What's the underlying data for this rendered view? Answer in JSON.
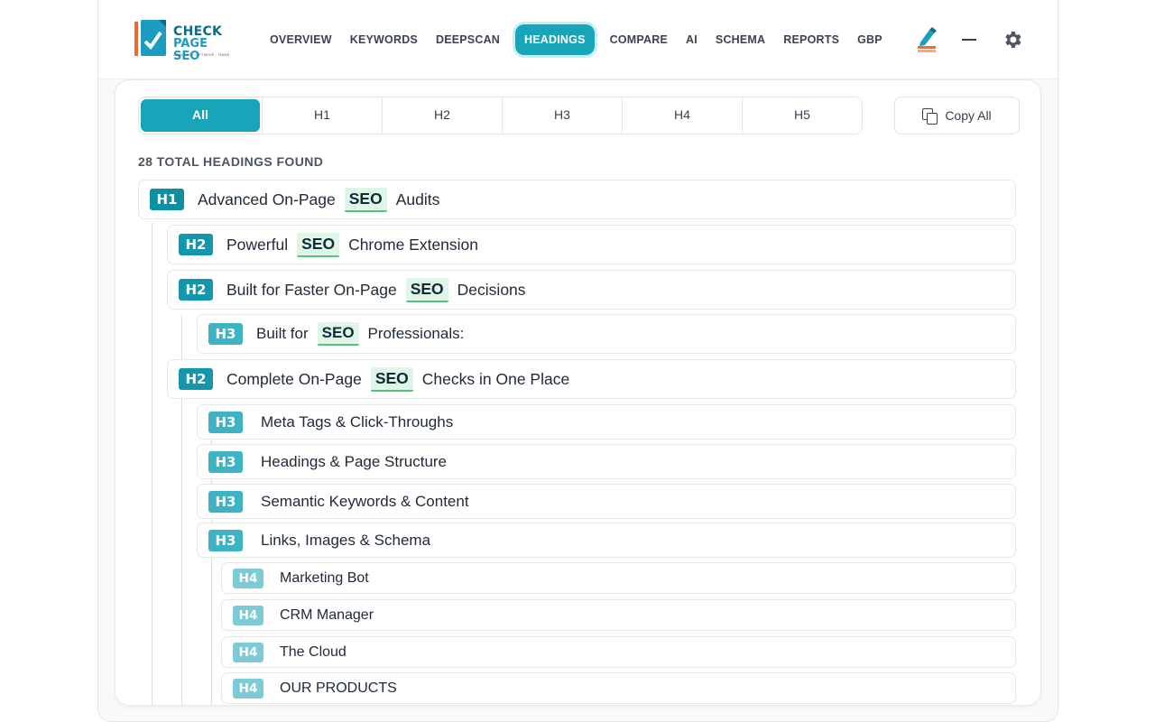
{
  "logo": {
    "line1": "CHECK",
    "line2": "PAGE SEO",
    "tagline": "ANALYZE · OPTIMIZE · RANK"
  },
  "nav": [
    "OVERVIEW",
    "KEYWORDS",
    "DEEPSCAN",
    "HEADINGS",
    "COMPARE",
    "AI",
    "SCHEMA",
    "REPORTS",
    "GBP"
  ],
  "active_nav": "HEADINGS",
  "filters": [
    "All",
    "H1",
    "H2",
    "H3",
    "H4",
    "H5"
  ],
  "active_filter": "All",
  "copy_all_label": "Copy All",
  "count_label": "28 TOTAL HEADINGS FOUND",
  "headings": [
    {
      "level": "H1",
      "before": "Advanced On-Page",
      "keyword": "SEO",
      "after": "Audits"
    },
    {
      "level": "H2",
      "before": "Powerful",
      "keyword": "SEO",
      "after": "Chrome Extension"
    },
    {
      "level": "H2",
      "before": "Built for Faster On-Page",
      "keyword": "SEO",
      "after": "Decisions"
    },
    {
      "level": "H3",
      "before": "Built for",
      "keyword": "SEO",
      "after": "Professionals:"
    },
    {
      "level": "H2",
      "before": "Complete On-Page",
      "keyword": "SEO",
      "after": "Checks in One Place"
    },
    {
      "level": "H3",
      "before": "Meta Tags & Click-Throughs",
      "keyword": "",
      "after": ""
    },
    {
      "level": "H3",
      "before": "Headings & Page Structure",
      "keyword": "",
      "after": ""
    },
    {
      "level": "H3",
      "before": "Semantic Keywords & Content",
      "keyword": "",
      "after": ""
    },
    {
      "level": "H3",
      "before": "Links, Images & Schema",
      "keyword": "",
      "after": ""
    },
    {
      "level": "H4",
      "before": "Marketing Bot",
      "keyword": "",
      "after": ""
    },
    {
      "level": "H4",
      "before": "CRM Manager",
      "keyword": "",
      "after": ""
    },
    {
      "level": "H4",
      "before": "The Cloud",
      "keyword": "",
      "after": ""
    },
    {
      "level": "H4",
      "before": "OUR PRODUCTS",
      "keyword": "",
      "after": ""
    }
  ],
  "colors": {
    "accent": "#18a4b9",
    "h1": "#0f8fa2",
    "h2": "#1497aa",
    "h3": "#3db3c4",
    "h4": "#7ccbd6",
    "keyword_bg": "#dff5e5",
    "keyword_underline": "#57c27b"
  },
  "icons": {
    "brush": "brush-icon",
    "minimize": "minimize-icon",
    "settings": "gear-icon",
    "copy": "copy-icon"
  }
}
